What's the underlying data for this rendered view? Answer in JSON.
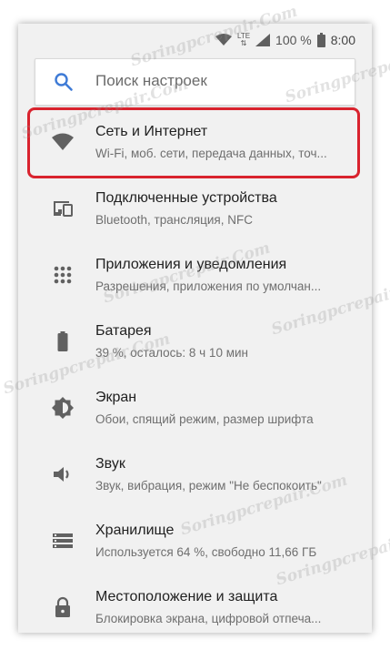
{
  "status_bar": {
    "network": "LTE",
    "battery_percent": "100 %",
    "time": "8:00"
  },
  "search": {
    "placeholder": "Поиск настроек"
  },
  "settings": [
    {
      "title": "Сеть и Интернет",
      "subtitle": "Wi-Fi, моб. сети, передача данных, точ...",
      "icon": "wifi-icon",
      "highlighted": true
    },
    {
      "title": "Подключенные устройства",
      "subtitle": "Bluetooth, трансляция, NFC",
      "icon": "devices-icon"
    },
    {
      "title": "Приложения и уведомления",
      "subtitle": "Разрешения, приложения по умолчан...",
      "icon": "apps-icon"
    },
    {
      "title": "Батарея",
      "subtitle": "39 %, осталось: 8 ч 10 мин",
      "icon": "battery-icon"
    },
    {
      "title": "Экран",
      "subtitle": "Обои, спящий режим, размер шрифта",
      "icon": "brightness-icon"
    },
    {
      "title": "Звук",
      "subtitle": "Звук, вибрация, режим \"Не беспокоить\"",
      "icon": "volume-icon"
    },
    {
      "title": "Хранилище",
      "subtitle": "Используется 64 %, свободно 11,66 ГБ",
      "icon": "storage-icon"
    },
    {
      "title": "Местоположение и защита",
      "subtitle": "Блокировка экрана, цифровой отпеча...",
      "icon": "lock-icon"
    }
  ],
  "watermark": "Soringpcrepair.Com",
  "colors": {
    "highlight": "#d9232e",
    "accent": "#3f7bd6",
    "icon": "#616161"
  }
}
